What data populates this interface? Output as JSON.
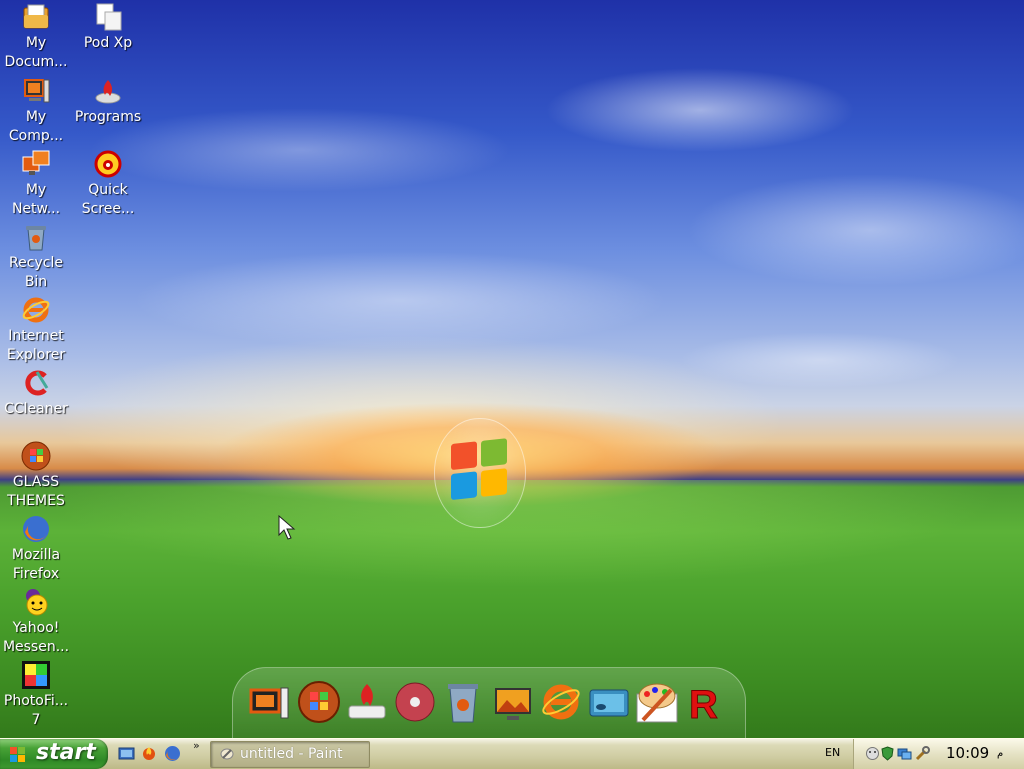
{
  "desktop": {
    "icons_left": [
      {
        "label": "My Docum..."
      },
      {
        "label": "My Comp..."
      },
      {
        "label": "My Netw..."
      },
      {
        "label": "Recycle Bin"
      },
      {
        "label": "Internet Explorer"
      },
      {
        "label": "CCleaner"
      },
      {
        "label": "GLASS THEMES"
      },
      {
        "label": "Mozilla Firefox"
      },
      {
        "label": "Yahoo! Messen..."
      },
      {
        "label": "PhotoFi... 7"
      }
    ],
    "icons_right": [
      {
        "label": "Pod Xp"
      },
      {
        "label": "Programs"
      },
      {
        "label": "Quick Scree..."
      }
    ]
  },
  "dock": {
    "items": [
      "my-computer-icon",
      "windows-orb-icon",
      "burner-icon",
      "dvd-icon",
      "recycle-bin-icon",
      "picture-gallery-icon",
      "internet-explorer-icon",
      "display-icon",
      "paint-icon",
      "r-app-icon"
    ]
  },
  "taskbar": {
    "start_label": "start",
    "quicklaunch_overflow": "»",
    "task_buttons": [
      {
        "label": "untitled - Paint"
      }
    ],
    "language": "EN",
    "clock": "10:09",
    "ampm": "م"
  },
  "colors": {
    "start_green": "#3f9a30",
    "taskbar_olive": "#cfcca2",
    "grass": "#4aa12c",
    "sky": "#3559c9"
  }
}
